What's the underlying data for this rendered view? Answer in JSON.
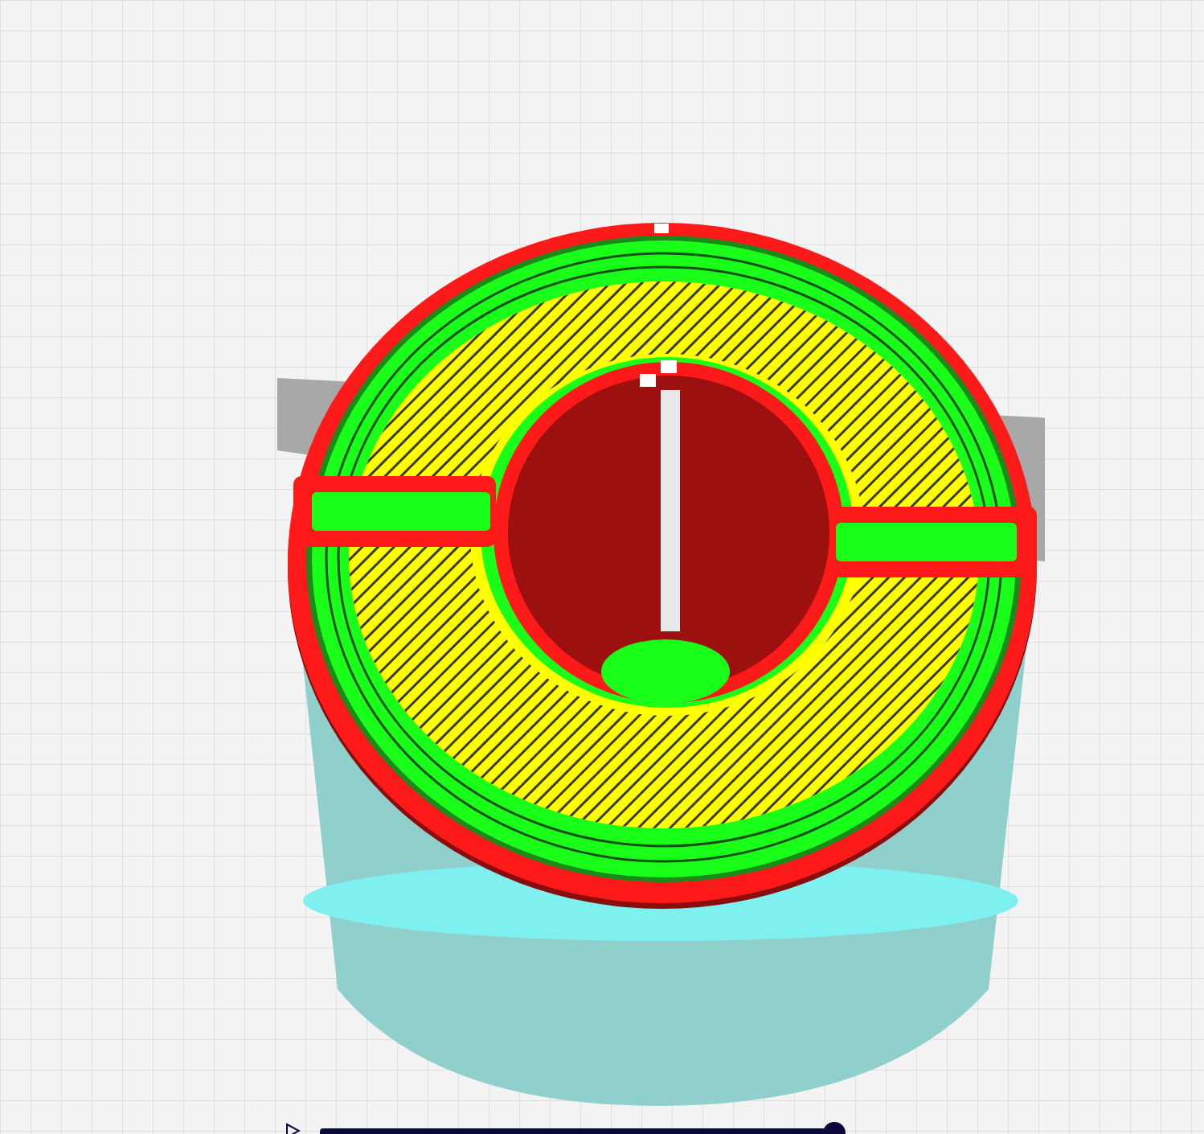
{
  "playback": {
    "playing": false
  },
  "layer_slider": {
    "level": 1
  }
}
